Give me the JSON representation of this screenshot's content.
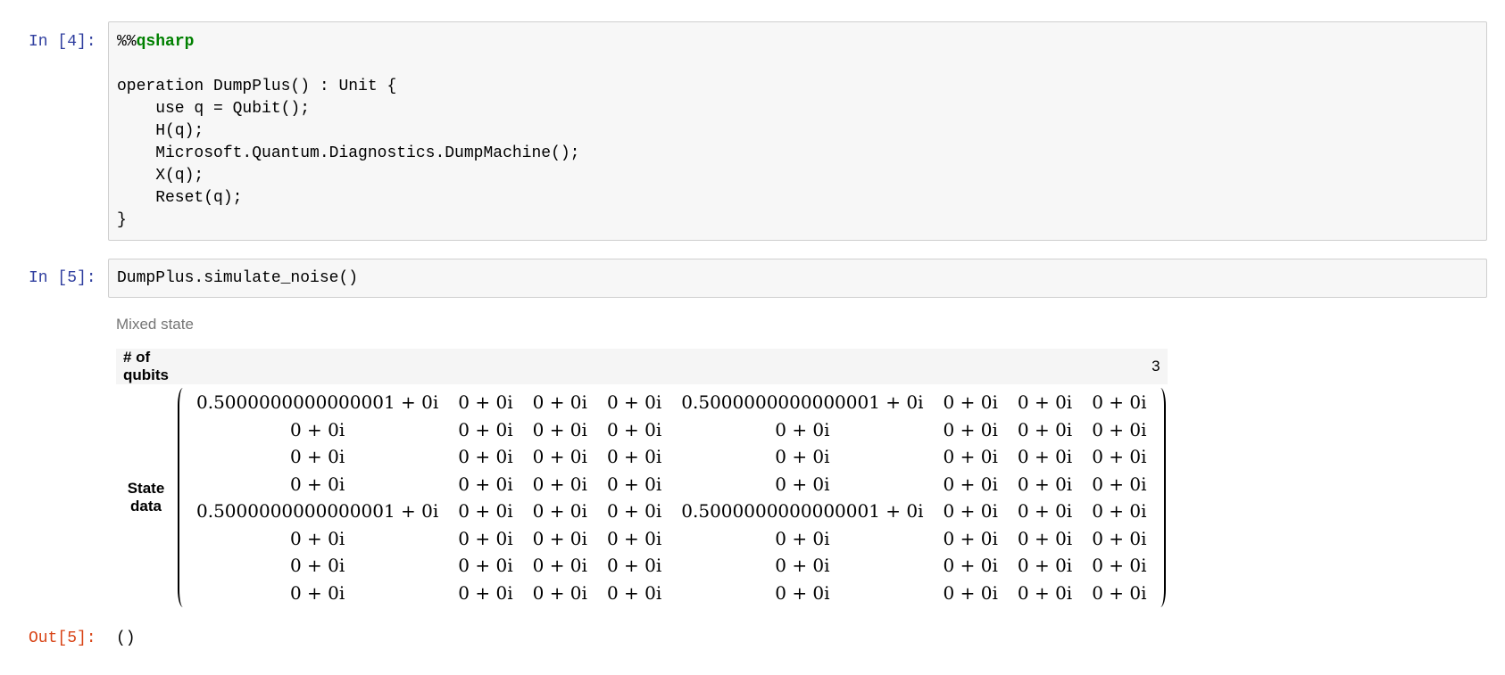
{
  "cells": {
    "c4": {
      "prompt": "In [4]:",
      "magic_prefix": "%%",
      "magic_name": "qsharp",
      "lines": [
        "",
        "operation DumpPlus() : Unit {",
        "    use q = Qubit();",
        "    H(q);",
        "    Microsoft.Quantum.Diagnostics.DumpMachine();",
        "    X(q);",
        "    Reset(q);",
        "}"
      ]
    },
    "c5": {
      "prompt": "In [5]:",
      "code": "DumpPlus.simulate_noise()",
      "output": {
        "title": "Mixed state",
        "header_label": "# of qubits",
        "header_value": "3",
        "state_label": "State data",
        "matrix": [
          [
            "0.5000000000000001 + 0i",
            "0 + 0i",
            "0 + 0i",
            "0 + 0i",
            "0.5000000000000001 + 0i",
            "0 + 0i",
            "0 + 0i",
            "0 + 0i"
          ],
          [
            "0 + 0i",
            "0 + 0i",
            "0 + 0i",
            "0 + 0i",
            "0 + 0i",
            "0 + 0i",
            "0 + 0i",
            "0 + 0i"
          ],
          [
            "0 + 0i",
            "0 + 0i",
            "0 + 0i",
            "0 + 0i",
            "0 + 0i",
            "0 + 0i",
            "0 + 0i",
            "0 + 0i"
          ],
          [
            "0 + 0i",
            "0 + 0i",
            "0 + 0i",
            "0 + 0i",
            "0 + 0i",
            "0 + 0i",
            "0 + 0i",
            "0 + 0i"
          ],
          [
            "0.5000000000000001 + 0i",
            "0 + 0i",
            "0 + 0i",
            "0 + 0i",
            "0.5000000000000001 + 0i",
            "0 + 0i",
            "0 + 0i",
            "0 + 0i"
          ],
          [
            "0 + 0i",
            "0 + 0i",
            "0 + 0i",
            "0 + 0i",
            "0 + 0i",
            "0 + 0i",
            "0 + 0i",
            "0 + 0i"
          ],
          [
            "0 + 0i",
            "0 + 0i",
            "0 + 0i",
            "0 + 0i",
            "0 + 0i",
            "0 + 0i",
            "0 + 0i",
            "0 + 0i"
          ],
          [
            "0 + 0i",
            "0 + 0i",
            "0 + 0i",
            "0 + 0i",
            "0 + 0i",
            "0 + 0i",
            "0 + 0i",
            "0 + 0i"
          ]
        ]
      },
      "out_prompt": "Out[5]:",
      "out_value": "()"
    }
  }
}
